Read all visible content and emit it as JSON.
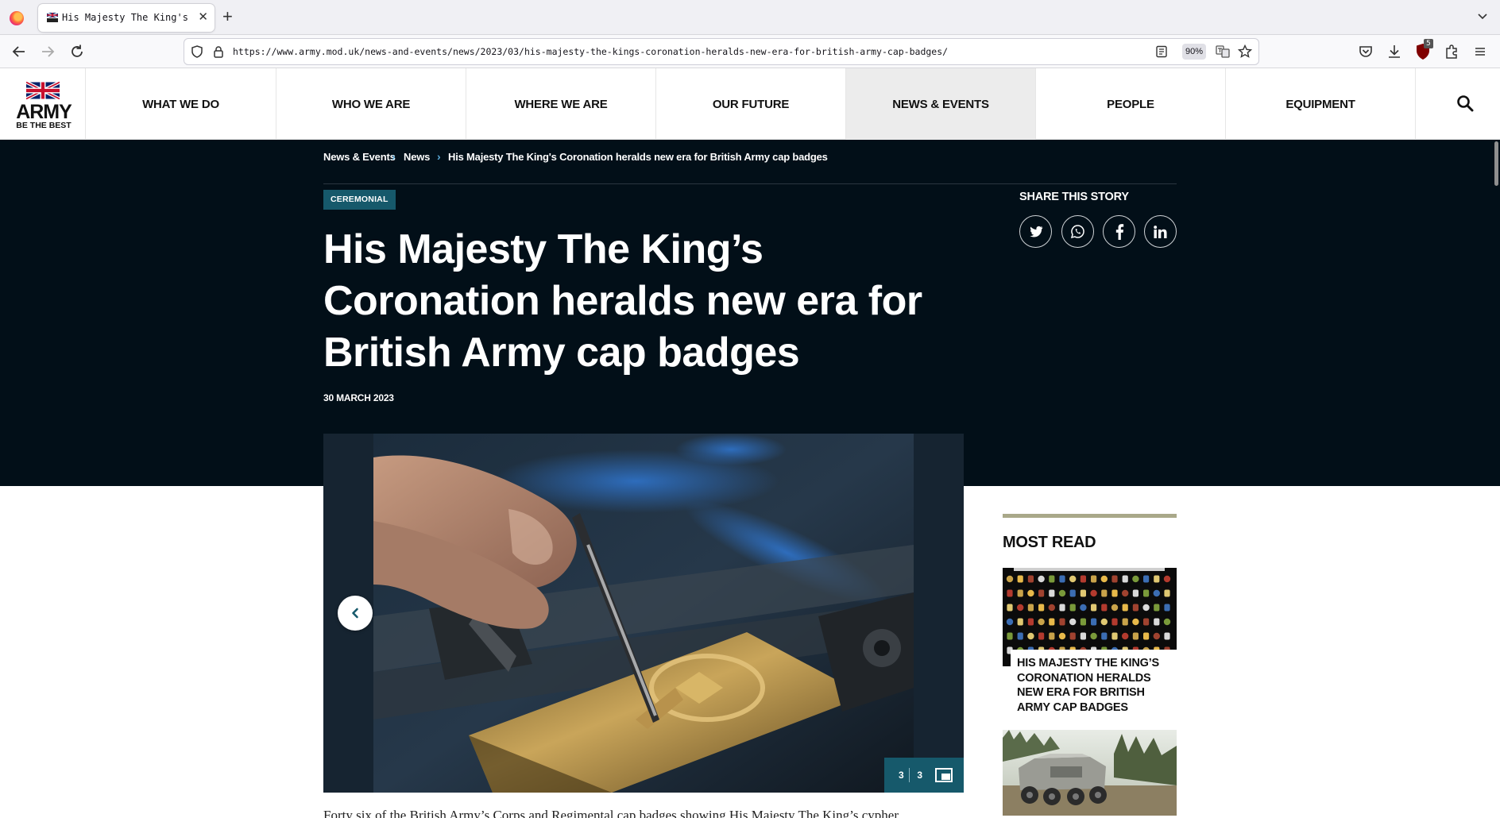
{
  "browser": {
    "tab_title": "His Majesty The King's Coron",
    "url": "https://www.army.mod.uk/news-and-events/news/2023/03/his-majesty-the-kings-coronation-heralds-new-era-for-british-army-cap-badges/",
    "zoom": "90%",
    "shield_badge": "5",
    "icons": [
      "firefox-logo",
      "back",
      "forward",
      "reload",
      "tracking-shield",
      "lock",
      "reader-view",
      "translate",
      "bookmark-star",
      "pocket",
      "downloads",
      "ublock",
      "extensions",
      "app-menu",
      "tab-list"
    ]
  },
  "site": {
    "logo_word": "ARMY",
    "logo_tagline": "BE THE BEST",
    "menu": [
      {
        "label": "WHAT WE DO"
      },
      {
        "label": "WHO WE ARE"
      },
      {
        "label": "WHERE WE ARE"
      },
      {
        "label": "OUR FUTURE"
      },
      {
        "label": "NEWS & EVENTS",
        "active": true
      },
      {
        "label": "PEOPLE"
      },
      {
        "label": "EQUIPMENT"
      }
    ]
  },
  "article": {
    "breadcrumb": [
      "News & Events",
      "News",
      "His Majesty The King's Coronation heralds new era for British Army cap badges"
    ],
    "tag": "CEREMONIAL",
    "headline": "His Majesty The King’s Coronation heralds new era for British Army cap badges",
    "date": "30 MARCH 2023",
    "gallery": {
      "current": "3",
      "total": "3"
    },
    "body_start": "Forty six of the British Army’s Corps and Regimental cap badges showing His Majesty The King’s cypher"
  },
  "share": {
    "title": "SHARE THIS STORY",
    "networks": [
      "twitter",
      "whatsapp",
      "facebook",
      "linkedin"
    ]
  },
  "most_read": {
    "title": "MOST READ",
    "items": [
      {
        "title": "HIS MAJESTY THE KING’S CORONATION HERALDS NEW ERA FOR BRITISH ARMY CAP BADGES"
      }
    ]
  },
  "colors": {
    "hero_bg": "#020f18",
    "accent_teal": "#16596b",
    "breadcrumb_sep": "#5aa9d6",
    "most_read_rule": "#a9a889"
  }
}
